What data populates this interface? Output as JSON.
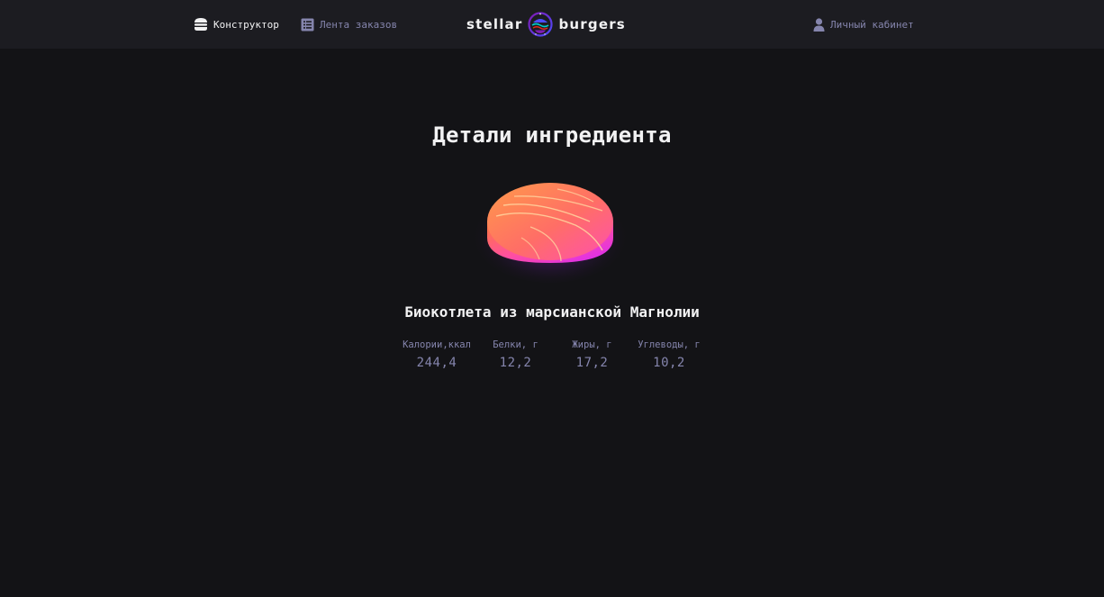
{
  "header": {
    "nav": {
      "constructor_label": "Конструктор",
      "constructor_icon": "burger-icon",
      "feed_label": "Лента заказов",
      "feed_icon": "list-icon",
      "account_label": "Личный кабинет",
      "account_icon": "profile-icon"
    },
    "logo": {
      "left_word": "stellar",
      "right_word": "burgers"
    }
  },
  "main": {
    "title": "Детали ингредиента",
    "ingredient_name": "Биокотлета из марсианской Магнолии",
    "nutrients": [
      {
        "label": "Калории,ккал",
        "value": "244,4"
      },
      {
        "label": "Белки, г",
        "value": "12,2"
      },
      {
        "label": "Жиры, г",
        "value": "17,2"
      },
      {
        "label": "Углеводы, г",
        "value": "10,2"
      }
    ]
  },
  "colors": {
    "background": "#131316",
    "header_bg": "#1c1c21",
    "text_primary": "#f2f2f3",
    "text_inactive": "#8585ad",
    "accent": "#4c4cff"
  }
}
